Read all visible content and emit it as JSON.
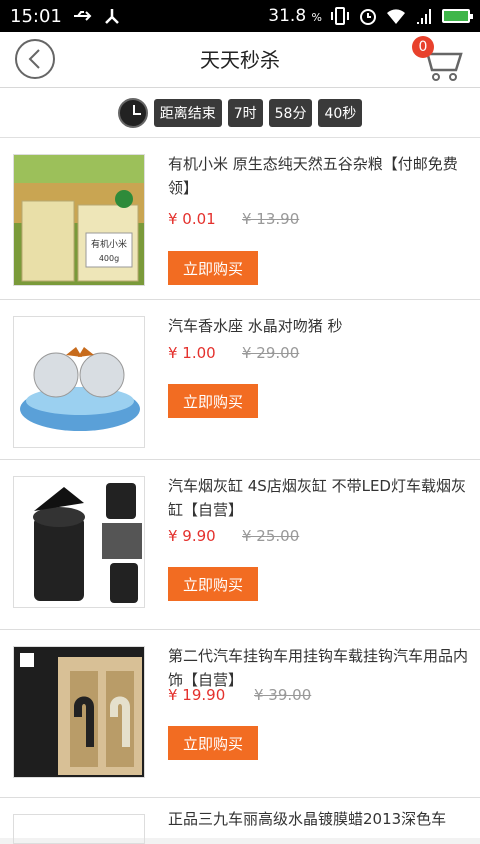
{
  "status": {
    "time": "15:01",
    "battery_percent": "31.8",
    "battery_unit": "%",
    "colors": {
      "battery_fill": "#3fb64a"
    },
    "icons": [
      "usb-icon",
      "share-icon",
      "vibrate-icon",
      "alarm-icon",
      "wifi-icon",
      "signal-icon",
      "battery-icon"
    ]
  },
  "header": {
    "title": "天天秒杀",
    "cart_count": "0"
  },
  "countdown": {
    "label": "距离结束",
    "hours": "7时",
    "minutes": "58分",
    "seconds": "40秒"
  },
  "products": [
    {
      "name": "有机小米 原生态纯天然五谷杂粮【付邮免费领】",
      "price": "¥ 0.01",
      "original_price": "¥ 13.90",
      "buy_label": "立即购买",
      "image_label": "有机小米",
      "image_sub": "400g"
    },
    {
      "name": "汽车香水座 水晶对吻猪 秒",
      "price": "¥ 1.00",
      "original_price": "¥ 29.00",
      "buy_label": "立即购买"
    },
    {
      "name": "汽车烟灰缸 4S店烟灰缸 不带LED灯车载烟灰缸【自营】",
      "price": "¥ 9.90",
      "original_price": "¥ 25.00",
      "buy_label": "立即购买"
    },
    {
      "name": "第二代汽车挂钩车用挂钩车载挂钩汽车用品内饰【自营】",
      "price": "¥ 19.90",
      "original_price": "¥ 39.00",
      "buy_label": "立即购买"
    }
  ],
  "partial_item": {
    "name": "正品三九车丽高级水晶镀膜蜡2013深色车"
  },
  "colors": {
    "accent": "#f26c22",
    "price": "#e4312d",
    "badge": "#e8412c"
  }
}
